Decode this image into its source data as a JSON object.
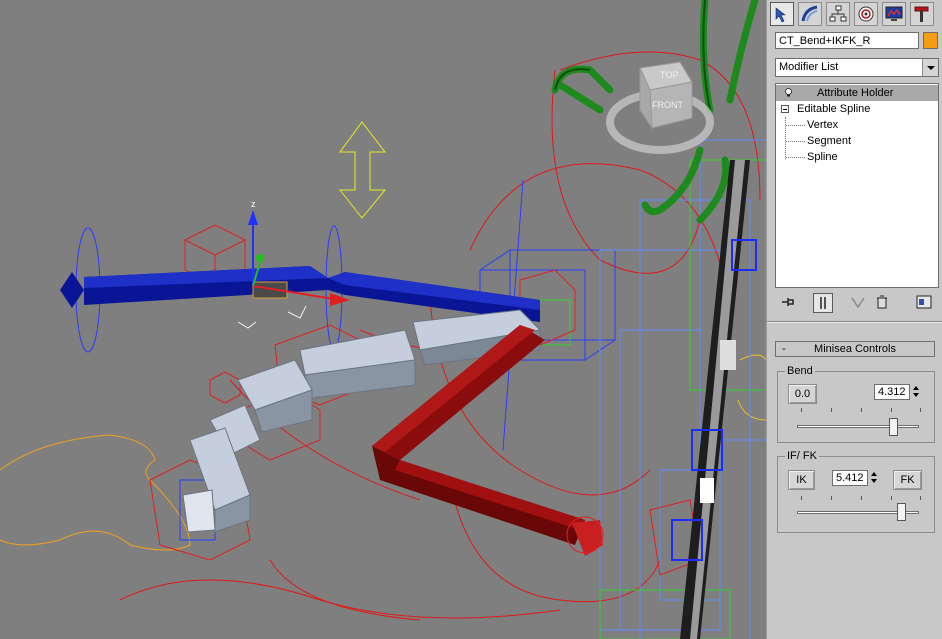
{
  "panel": {
    "tabs": [
      {
        "name": "create-tab",
        "icon": "create-pointer-icon",
        "active": true
      },
      {
        "name": "modify-tab",
        "icon": "modify-arc-icon",
        "active": false
      },
      {
        "name": "hierarchy-tab",
        "icon": "hierarchy-icon",
        "active": false
      },
      {
        "name": "motion-tab",
        "icon": "motion-icon",
        "active": false
      },
      {
        "name": "display-tab",
        "icon": "display-icon",
        "active": false
      },
      {
        "name": "utilities-tab",
        "icon": "hammer-icon",
        "active": false
      }
    ],
    "object_name": "CT_Bend+IKFK_R",
    "object_color": "#f59d12",
    "modifier_list": "Modifier List",
    "stack": {
      "selected": "Attribute Holder",
      "base": "Editable Spline",
      "subobjects": [
        "Vertex",
        "Segment",
        "Spline"
      ]
    }
  },
  "rollout": {
    "title": "Minisea Controls",
    "collapse_symbol": "-",
    "bend": {
      "label": "Bend",
      "reset_button": "0.0",
      "value": "4.312",
      "slider_fraction": 0.79
    },
    "ikfk": {
      "label": "IF/ FK",
      "ik_button": "IK",
      "fk_button": "FK",
      "value": "5.412",
      "slider_fraction": 0.86
    }
  },
  "viewport": {
    "gizmo_axis_label": "z",
    "viewcube_top": "TOP",
    "viewcube_front": "FRONT"
  }
}
